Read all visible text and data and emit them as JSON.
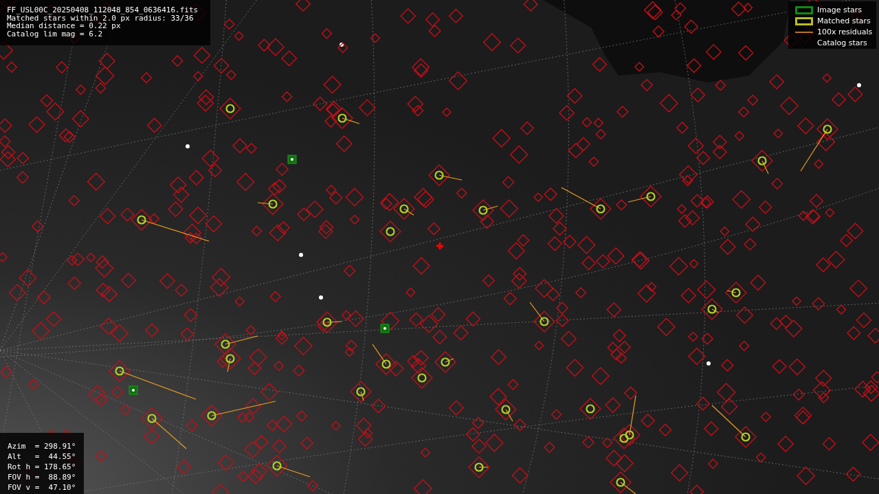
{
  "info_box": {
    "lines": [
      "FF_USL00C_20250408_112048_854_0636416.fits",
      "Matched stars within 2.0 px radius: 33/36",
      "Median distance = 0.22 px",
      "Catalog lim mag = 6.2"
    ]
  },
  "legend": [
    {
      "kind": "image",
      "label": "Image stars"
    },
    {
      "kind": "matched",
      "label": "Matched stars"
    },
    {
      "kind": "residual",
      "label": "100x residuals"
    },
    {
      "kind": "catalog",
      "label": "Catalog stars"
    }
  ],
  "pointing": {
    "lines": [
      "Azim  = 298.91°",
      "Alt   =  44.55°",
      "Rot h = 178.65°",
      "FOV h =  88.89°",
      "FOV v =  47.10°"
    ]
  }
}
